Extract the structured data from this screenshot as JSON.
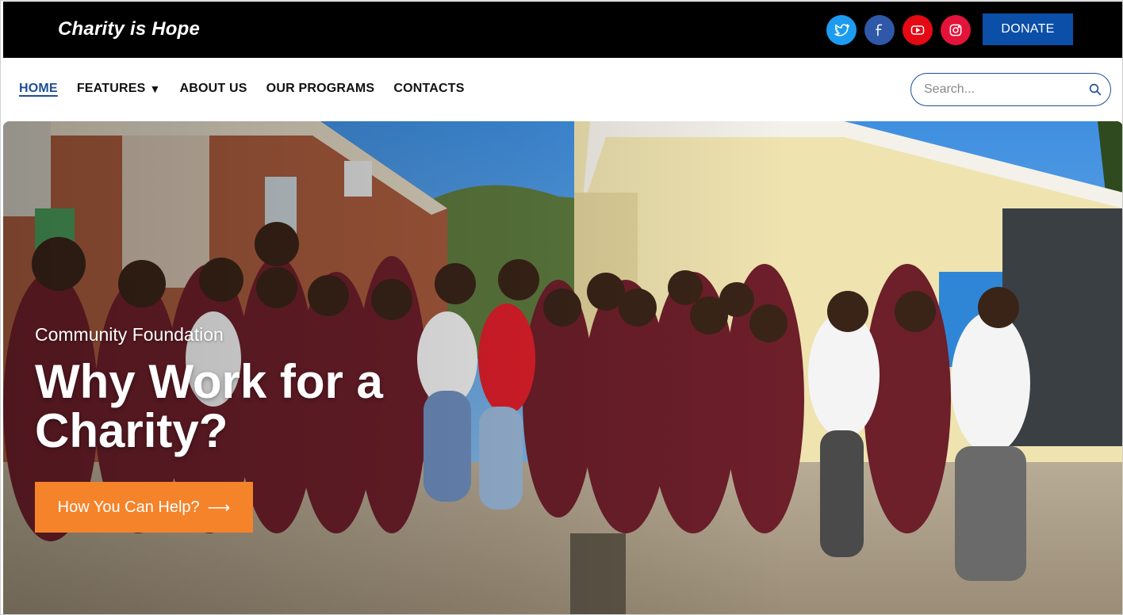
{
  "header": {
    "brand": "Charity is Hope",
    "social": [
      {
        "name": "twitter",
        "color": "#1d9bf0"
      },
      {
        "name": "facebook",
        "color": "#2f58a8"
      },
      {
        "name": "youtube",
        "color": "#e50914"
      },
      {
        "name": "instagram",
        "color": "#e4133a"
      }
    ],
    "donate_label": "DONATE",
    "donate_color": "#0b4fa8"
  },
  "nav": {
    "items": [
      {
        "label": "HOME",
        "active": true
      },
      {
        "label": "FEATURES",
        "dropdown": true
      },
      {
        "label": "ABOUT US"
      },
      {
        "label": "OUR PROGRAMS"
      },
      {
        "label": "CONTACTS"
      }
    ],
    "caret": "▼",
    "search_placeholder": "Search...",
    "accent": "#1e4e96"
  },
  "hero": {
    "eyebrow": "Community Foundation",
    "title": "Why Work for a Charity?",
    "cta_label": "How You Can Help?",
    "cta_arrow": "⟶",
    "cta_color": "#f5832a",
    "image": "group-photo-students-in-maroon-uniforms"
  }
}
